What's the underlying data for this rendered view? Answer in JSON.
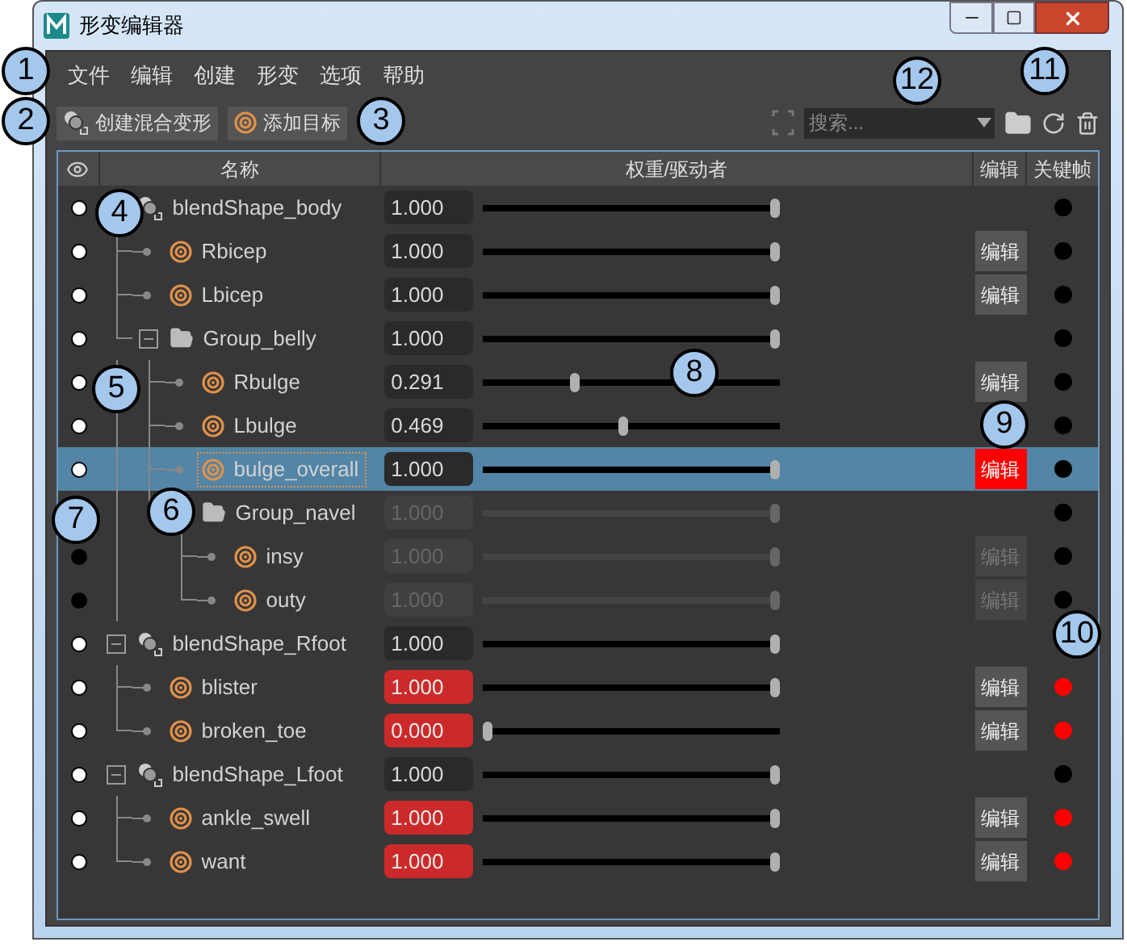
{
  "window": {
    "title": "形变编辑器"
  },
  "menu": [
    "文件",
    "编辑",
    "创建",
    "形变",
    "选项",
    "帮助"
  ],
  "toolbar": {
    "buttons": [
      "创建混合变形",
      "添加目标"
    ],
    "search": {
      "placeholder": "搜索..."
    }
  },
  "table": {
    "columns": [
      "名称",
      "权重/驱动者",
      "编辑",
      "关键帧"
    ],
    "rows": [
      {
        "kind": "blendshape",
        "name": "blendShape_body",
        "visible": true,
        "weight": "1.000",
        "level": 1,
        "keyed": false,
        "disabled": false,
        "selected": false,
        "children": [
          {
            "kind": "target",
            "name": "Rbicep",
            "visible": true,
            "weight": "1.000",
            "level": 1,
            "keyed": false,
            "disabled": false,
            "selected": false,
            "edit": "编辑",
            "editing": false
          },
          {
            "kind": "target",
            "name": "Lbicep",
            "visible": true,
            "weight": "1.000",
            "level": 1,
            "keyed": false,
            "disabled": false,
            "selected": false,
            "edit": "编辑",
            "editing": false
          },
          {
            "kind": "group",
            "name": "Group_belly",
            "visible": true,
            "weight": "1.000",
            "level": 1,
            "keyed": false,
            "disabled": false,
            "selected": false,
            "expanded": true,
            "children": [
              {
                "kind": "target",
                "name": "Rbulge",
                "visible": true,
                "weight": "0.291",
                "level": 0.3,
                "keyed": false,
                "disabled": false,
                "selected": false,
                "edit": "编辑",
                "editing": false
              },
              {
                "kind": "target",
                "name": "Lbulge",
                "visible": true,
                "weight": "0.469",
                "level": 0.469,
                "keyed": false,
                "disabled": false,
                "selected": false
              },
              {
                "kind": "target",
                "name": "bulge_overall",
                "visible": true,
                "weight": "1.000",
                "level": 1,
                "keyed": false,
                "disabled": false,
                "selected": true,
                "edit": "编辑",
                "editing": true
              },
              {
                "kind": "group",
                "name": "Group_navel",
                "weight": "1.000",
                "level": 1,
                "keyed": false,
                "disabled": true,
                "selected": false,
                "children": [
                  {
                    "kind": "target",
                    "name": "insy",
                    "visible": false,
                    "weight": "1.000",
                    "level": 1,
                    "keyed": false,
                    "disabled": true,
                    "selected": false,
                    "edit": "编辑",
                    "editing": false
                  },
                  {
                    "kind": "target",
                    "name": "outy",
                    "visible": false,
                    "weight": "1.000",
                    "level": 1,
                    "keyed": false,
                    "disabled": true,
                    "selected": false,
                    "edit": "编辑",
                    "editing": false
                  }
                ]
              }
            ]
          }
        ]
      },
      {
        "kind": "blendshape",
        "name": "blendShape_Rfoot",
        "visible": true,
        "weight": "1.000",
        "level": 1,
        "disabled": false,
        "selected": false,
        "expanded": true,
        "children": [
          {
            "kind": "target",
            "name": "blister",
            "visible": true,
            "weight": "1.000",
            "level": 1,
            "keyed": true,
            "disabled": false,
            "selected": false,
            "edit": "编辑",
            "editing": false
          },
          {
            "kind": "target",
            "name": "broken_toe",
            "visible": true,
            "weight": "0.000",
            "level": 0,
            "keyed": true,
            "disabled": false,
            "selected": false,
            "edit": "编辑",
            "editing": false
          }
        ]
      },
      {
        "kind": "blendshape",
        "name": "blendShape_Lfoot",
        "visible": true,
        "weight": "1.000",
        "level": 1,
        "keyed": false,
        "disabled": false,
        "selected": false,
        "expanded": true,
        "children": [
          {
            "kind": "target",
            "name": "ankle_swell",
            "visible": true,
            "weight": "1.000",
            "level": 1,
            "keyed": true,
            "disabled": false,
            "selected": false,
            "edit": "编辑",
            "editing": false
          },
          {
            "kind": "target",
            "name": "want",
            "visible": true,
            "weight": "1.000",
            "level": 1,
            "keyed": true,
            "disabled": false,
            "selected": false,
            "edit": "编辑",
            "editing": false
          }
        ]
      }
    ]
  },
  "callouts": [
    "1",
    "2",
    "3",
    "4",
    "5",
    "6",
    "7",
    "8",
    "9",
    "10",
    "11",
    "12"
  ]
}
